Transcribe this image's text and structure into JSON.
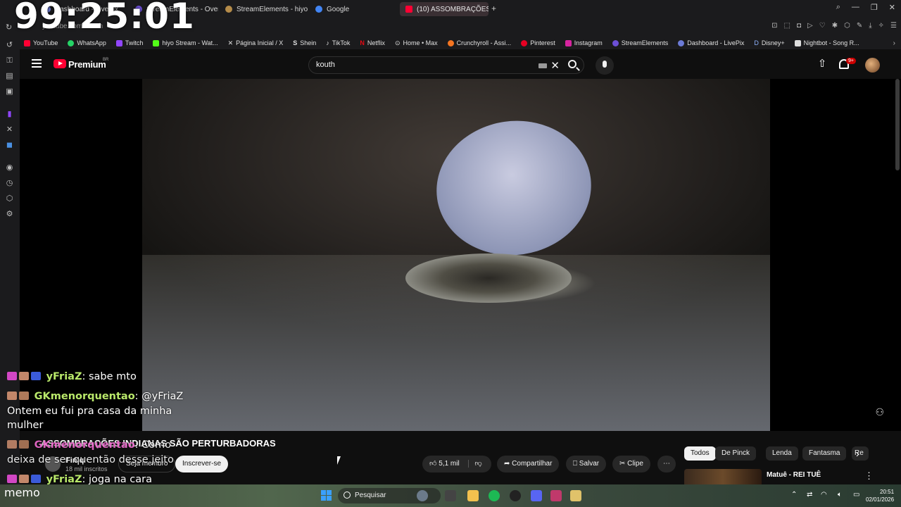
{
  "overlay": {
    "clock": "99:25:01",
    "name_label": "memo"
  },
  "tabs": [
    {
      "label": "Dashboard - LivePix",
      "color": "#6c7bd6"
    },
    {
      "label": "StreamElements - Overlay",
      "color": "#6c4fd6"
    },
    {
      "label": "StreamElements - hiyo",
      "color": "#6c4fd6"
    },
    {
      "label": "Google",
      "color": "#4285f4"
    },
    {
      "label": "(10) ASSOMBRAÇÕES INDI...",
      "color": "#ff0033",
      "active": true
    }
  ],
  "address_bar": {
    "url": "youtube.com/watch"
  },
  "bookmarks": [
    {
      "label": "YouTube",
      "color": "#ff0033"
    },
    {
      "label": "WhatsApp",
      "color": "#25d366"
    },
    {
      "label": "Twitch",
      "color": "#9146ff"
    },
    {
      "label": "hiyo Stream - Wat...",
      "color": "#53fc18"
    },
    {
      "label": "Página Inicial / X",
      "color": "#ffffff"
    },
    {
      "label": "Shein",
      "color": "#ffffff"
    },
    {
      "label": "TikTok",
      "color": "#ffffff"
    },
    {
      "label": "Netflix",
      "color": "#e50914"
    },
    {
      "label": "Home • Max",
      "color": "#ffffff"
    },
    {
      "label": "Crunchyroll - Assi...",
      "color": "#f47521"
    },
    {
      "label": "Pinterest",
      "color": "#e60023"
    },
    {
      "label": "Instagram",
      "color": "#d6249f"
    },
    {
      "label": "StreamElements",
      "color": "#6c4fd6"
    },
    {
      "label": "Dashboard - LivePix",
      "color": "#6c7bd6"
    },
    {
      "label": "Disney+",
      "color": "#113ccf"
    },
    {
      "label": "Nightbot - Song R...",
      "color": "#ffffff"
    }
  ],
  "youtube": {
    "brand": "Premium",
    "region": "BR",
    "search_value": "kouth",
    "notification_count": "9+"
  },
  "chat": [
    {
      "user": "yFriaZ",
      "message": "sabe mto"
    },
    {
      "user": "GKmenorquentao",
      "message": "@yFriaZ"
    },
    {
      "user": "",
      "message": "Ontem eu fui pra casa da minha"
    },
    {
      "user": "",
      "message": "mulher"
    },
    {
      "user": "GKmenorquentao",
      "message": "Como"
    },
    {
      "user": "",
      "message": "deixa de ser quentão desse jeito"
    },
    {
      "user": "yFriaZ",
      "message": "joga na cara"
    }
  ],
  "video": {
    "title": "ASSOMBRAÇÕES INDIANAS SÃO PERTURBADORAS",
    "channel": "Fin q",
    "subscribers": "18 mil inscritos",
    "join_label": "Seja membro",
    "subscribe_label": "Inscrever-se",
    "likes": "5,1 mil",
    "share_label": "Compartilhar",
    "save_label": "Salvar",
    "clip_label": "Clipe"
  },
  "chips": [
    "Todos",
    "De Pinck",
    "Lenda",
    "Fantasma",
    "Re"
  ],
  "recommendation": {
    "title": "Matuê - REI TUÊ"
  },
  "taskbar": {
    "search_label": "Pesquisar",
    "time": "20:51",
    "date": "02/01/2026"
  }
}
